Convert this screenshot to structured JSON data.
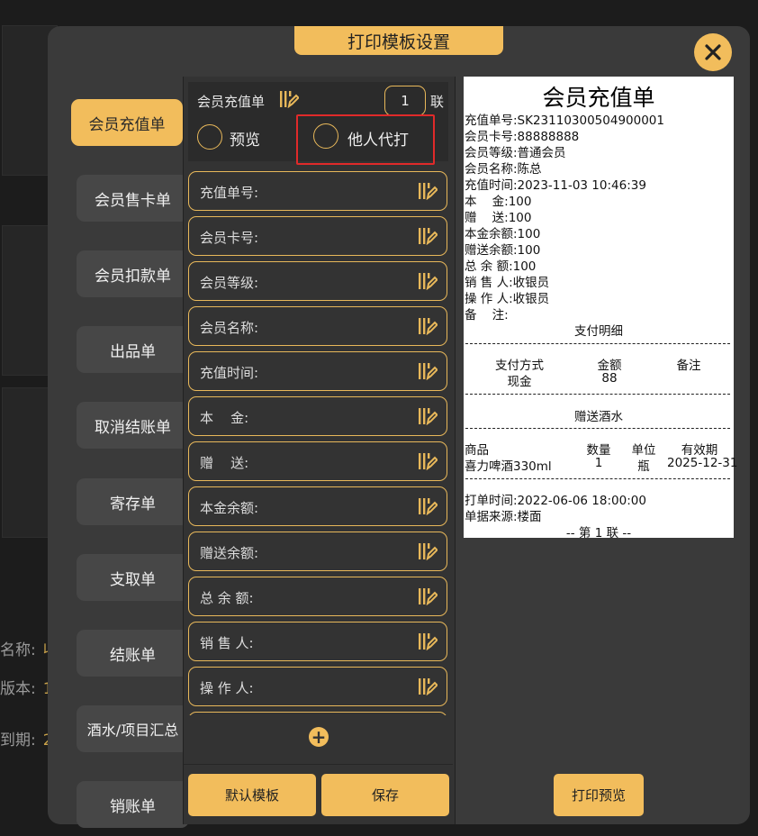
{
  "dialog": {
    "title": "打印模板设置",
    "close_icon": "close-icon",
    "accent": "#f2bd5c"
  },
  "background": {
    "labels": [
      {
        "label": "名称:",
        "value": "收"
      },
      {
        "label": "版本:",
        "value": "1"
      },
      {
        "label": "到期:",
        "value": "2"
      }
    ]
  },
  "sidebar": {
    "items": [
      {
        "label": "会员充值单",
        "active": true
      },
      {
        "label": "会员售卡单"
      },
      {
        "label": "会员扣款单"
      },
      {
        "label": "出品单"
      },
      {
        "label": "取消结账单"
      },
      {
        "label": "寄存单"
      },
      {
        "label": "支取单"
      },
      {
        "label": "结账单"
      },
      {
        "label": "酒水/项目汇总"
      },
      {
        "label": "销账单"
      }
    ]
  },
  "editor": {
    "template_name": "会员充值单",
    "copies": "1",
    "copies_unit": "联",
    "options": [
      {
        "label": "预览"
      },
      {
        "label": "他人代打"
      }
    ],
    "fields": [
      {
        "label": "充值单号:"
      },
      {
        "label": "会员卡号:"
      },
      {
        "label": "会员等级:"
      },
      {
        "label": "会员名称:"
      },
      {
        "label": "充值时间:"
      },
      {
        "label": "本    金:"
      },
      {
        "label": "赠    送:"
      },
      {
        "label": "本金余额:"
      },
      {
        "label": "赠送余额:"
      },
      {
        "label": "总 余 额:"
      },
      {
        "label": "销 售 人:"
      },
      {
        "label": "操 作 人:"
      }
    ],
    "add_icon": "plus-icon",
    "buttons": {
      "default": "默认模板",
      "save": "保存"
    }
  },
  "preview": {
    "title": "会员充值单",
    "lines": [
      "充值单号:SK23110300504900001",
      "会员卡号:88888888",
      "会员等级:普通会员",
      "会员名称:陈总",
      "充值时间:2023-11-03 10:46:39",
      "本    金:100",
      "赠    送:100",
      "本金余额:100",
      "赠送余额:100",
      "总 余 额:100",
      "销 售 人:收银员",
      "操 作 人:收银员",
      "备    注:"
    ],
    "payment_title": "支付明细",
    "payment_headers": [
      "支付方式",
      "金额",
      "备注"
    ],
    "payment_row": [
      "现金",
      "88",
      ""
    ],
    "gift_title": "赠送酒水",
    "goods_headers": [
      "商品",
      "数量",
      "单位",
      "有效期"
    ],
    "goods_row": [
      "喜力啤酒330ml",
      "1",
      "瓶",
      "2025-12-31"
    ],
    "print_time": "打单时间:2022-06-06 18:00:00",
    "source": "单据来源:楼面",
    "copy_mark": "-- 第 1 联 --",
    "print_preview_button": "打印预览"
  }
}
